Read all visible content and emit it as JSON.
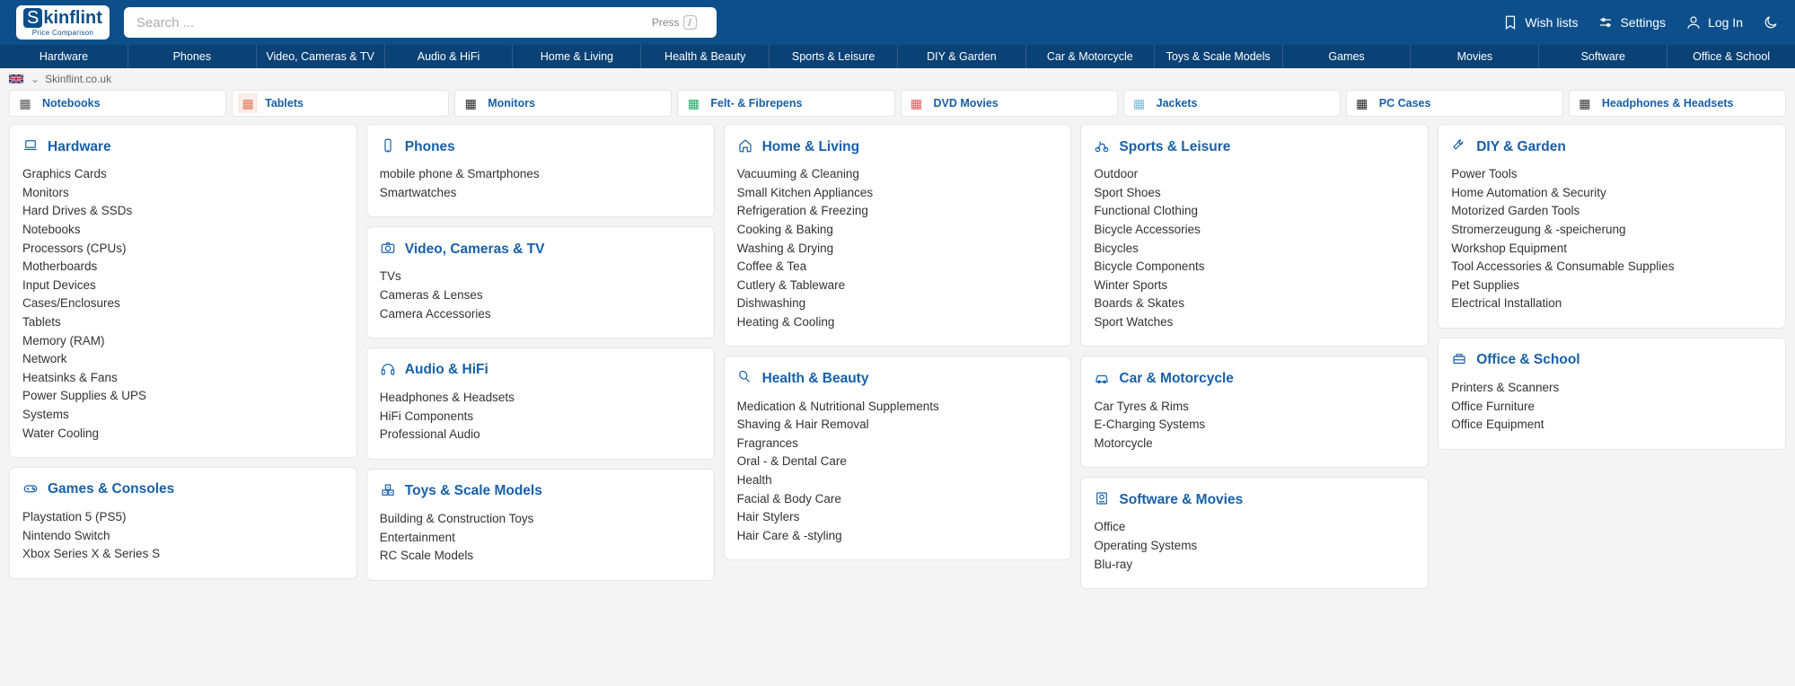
{
  "search": {
    "placeholder": "Search ...",
    "hint_press": "Press",
    "hint_key": "/"
  },
  "header_actions": {
    "wish": "Wish lists",
    "settings": "Settings",
    "login": "Log In"
  },
  "nav": [
    "Hardware",
    "Phones",
    "Video, Cameras & TV",
    "Audio & HiFi",
    "Home & Living",
    "Health & Beauty",
    "Sports & Leisure",
    "DIY & Garden",
    "Car & Motorcycle",
    "Toys & Scale Models",
    "Games",
    "Movies",
    "Software",
    "Office & School"
  ],
  "crumb": "Skinflint.co.uk",
  "quick": [
    {
      "label": "Notebooks"
    },
    {
      "label": "Tablets"
    },
    {
      "label": "Monitors"
    },
    {
      "label": "Felt- & Fibrepens"
    },
    {
      "label": "DVD Movies"
    },
    {
      "label": "Jackets"
    },
    {
      "label": "PC Cases"
    },
    {
      "label": "Headphones & Headsets"
    }
  ],
  "cards": {
    "hardware": {
      "title": "Hardware",
      "items": [
        "Graphics Cards",
        "Monitors",
        "Hard Drives & SSDs",
        "Notebooks",
        "Processors (CPUs)",
        "Motherboards",
        "Input Devices",
        "Cases/Enclosures",
        "Tablets",
        "Memory (RAM)",
        "Network",
        "Heatsinks & Fans",
        "Power Supplies & UPS",
        "Systems",
        "Water Cooling"
      ]
    },
    "games": {
      "title": "Games & Consoles",
      "items": [
        "Playstation 5 (PS5)",
        "Nintendo Switch",
        "Xbox Series X & Series S"
      ]
    },
    "phones": {
      "title": "Phones",
      "items": [
        "mobile phone & Smartphones",
        "Smartwatches"
      ]
    },
    "video": {
      "title": "Video, Cameras & TV",
      "items": [
        "TVs",
        "Cameras & Lenses",
        "Camera Accessories"
      ]
    },
    "audio": {
      "title": "Audio & HiFi",
      "items": [
        "Headphones & Headsets",
        "HiFi Components",
        "Professional Audio"
      ]
    },
    "toys": {
      "title": "Toys & Scale Models",
      "items": [
        "Building & Construction Toys",
        "Entertainment",
        "RC Scale Models"
      ]
    },
    "home": {
      "title": "Home & Living",
      "items": [
        "Vacuuming & Cleaning",
        "Small Kitchen Appliances",
        "Refrigeration & Freezing",
        "Cooking & Baking",
        "Washing & Drying",
        "Coffee & Tea",
        "Cutlery & Tableware",
        "Dishwashing",
        "Heating & Cooling"
      ]
    },
    "health": {
      "title": "Health & Beauty",
      "items": [
        "Medication & Nutritional Supplements",
        "Shaving & Hair Removal",
        "Fragrances",
        "Oral - & Dental Care",
        "Health",
        "Facial & Body Care",
        "Hair Stylers",
        "Hair Care & -styling"
      ]
    },
    "sports": {
      "title": "Sports & Leisure",
      "items": [
        "Outdoor",
        "Sport Shoes",
        "Functional Clothing",
        "Bicycle Accessories",
        "Bicycles",
        "Bicycle Components",
        "Winter Sports",
        "Boards & Skates",
        "Sport Watches"
      ]
    },
    "car": {
      "title": "Car & Motorcycle",
      "items": [
        "Car Tyres & Rims",
        "E-Charging Systems",
        "Motorcycle"
      ]
    },
    "software": {
      "title": "Software & Movies",
      "items": [
        "Office",
        "Operating Systems",
        "Blu-ray"
      ]
    },
    "diy": {
      "title": "DIY & Garden",
      "items": [
        "Power Tools",
        "Home Automation & Security",
        "Motorized Garden Tools",
        "Stromerzeugung & -speicherung",
        "Workshop Equipment",
        "Tool Accessories & Consumable Supplies",
        "Pet Supplies",
        "Electrical Installation"
      ]
    },
    "office": {
      "title": "Office & School",
      "items": [
        "Printers & Scanners",
        "Office Furniture",
        "Office Equipment"
      ]
    }
  }
}
